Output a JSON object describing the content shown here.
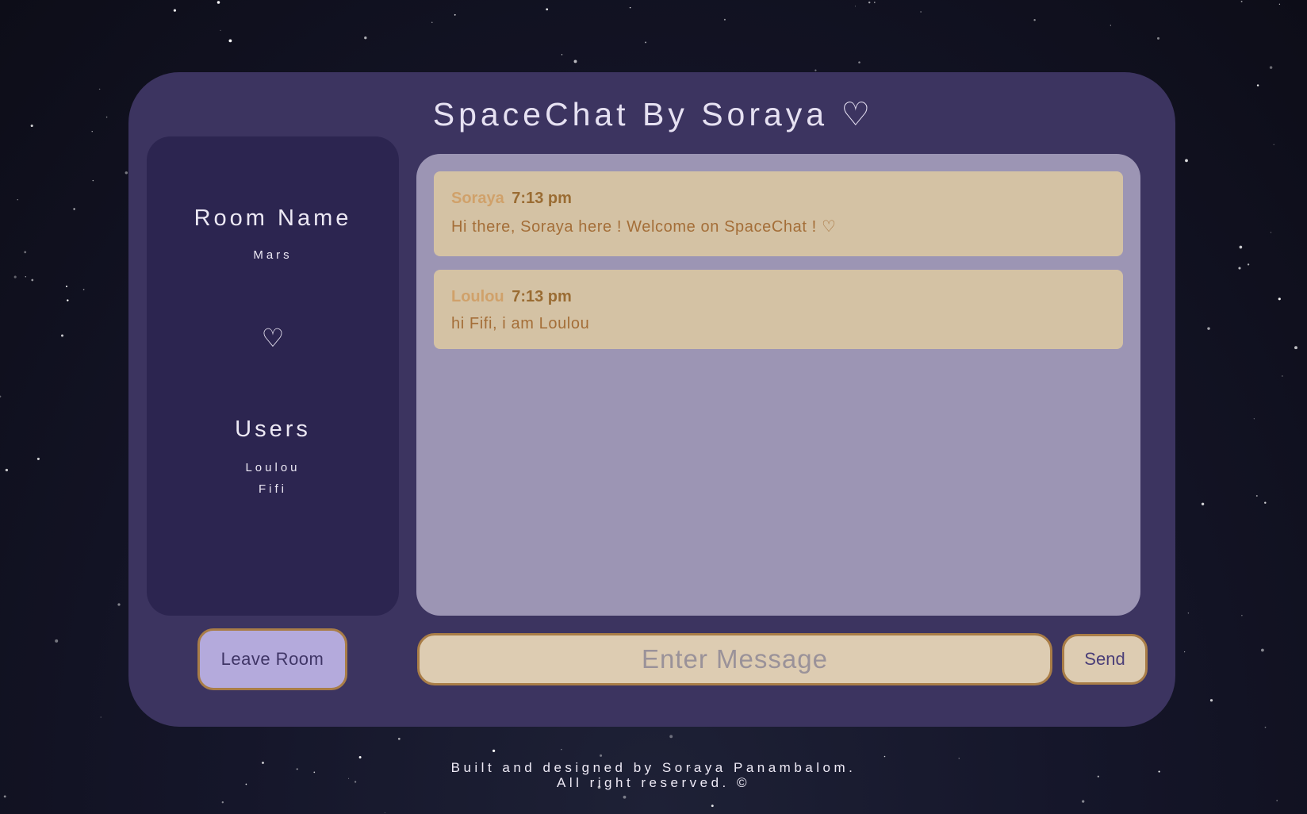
{
  "header": {
    "title": "SpaceChat By Soraya ♡"
  },
  "sidebar": {
    "room_heading": "Room Name",
    "room_name": "Mars",
    "heart": "♡",
    "users_heading": "Users",
    "users": [
      "Loulou",
      "Fifi"
    ]
  },
  "messages": [
    {
      "author": "Soraya",
      "time": "7:13 pm",
      "text": "Hi there, Soraya here ! Welcome on SpaceChat ! ♡"
    },
    {
      "author": "Loulou",
      "time": "7:13 pm",
      "text": "hi Fifi, i am Loulou"
    }
  ],
  "composer": {
    "placeholder": "Enter Message",
    "value": "",
    "send_label": "Send"
  },
  "actions": {
    "leave_label": "Leave Room"
  },
  "footer": {
    "line1": "Built and designed by Soraya Panambalom.",
    "line2": "All right reserved. ©"
  },
  "colors": {
    "card_bg": "#3c3460",
    "sidebar_bg": "#2c2550",
    "messages_bg": "#9c95b4",
    "message_bg": "#d4c2a4",
    "accent_border": "#a97d47",
    "leave_button_bg": "#b4aadc"
  }
}
